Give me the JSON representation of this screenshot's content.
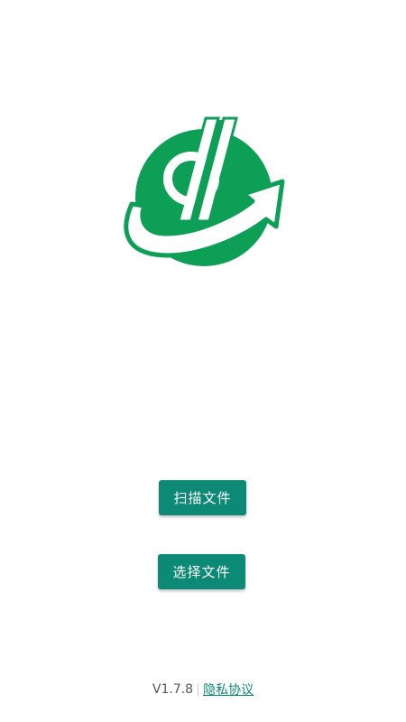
{
  "app": {
    "logo_icon": "green-currency-arrow-logo",
    "brand_color": "#0d9f55",
    "accent_color": "#0d8a76"
  },
  "actions": {
    "scan_label": "扫描文件",
    "select_label": "选择文件"
  },
  "footer": {
    "version": "V1.7.8",
    "privacy_label": "隐私协议"
  }
}
